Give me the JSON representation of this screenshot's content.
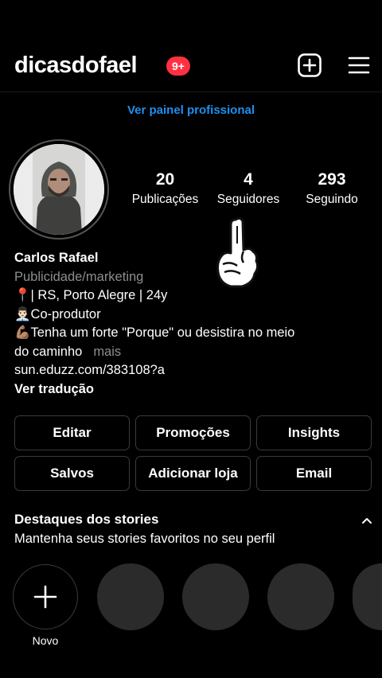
{
  "header": {
    "username": "dicasdofael",
    "notification_badge": "9+",
    "add_icon": "plus-square-icon",
    "menu_icon": "hamburger-menu-icon"
  },
  "professional_dashboard_link": "Ver painel profissional",
  "profile": {
    "stats": [
      {
        "value": "20",
        "label": "Publicações"
      },
      {
        "value": "4",
        "label": "Seguidores"
      },
      {
        "value": "293",
        "label": "Seguindo"
      }
    ],
    "name": "Carlos Rafael",
    "category": "Publicidade/marketing",
    "bio_lines": [
      "📍| RS, Porto Alegre | 24y",
      "👨🏻‍💼Co-produtor",
      "💪🏽Tenha um forte \"Porque\" ou desistira no meio",
      "do caminho"
    ],
    "more_label": "mais",
    "link": "sun.eduzz.com/383108?a",
    "translate_label": "Ver tradução"
  },
  "action_buttons": [
    [
      "Editar",
      "Promoções",
      "Insights"
    ],
    [
      "Salvos",
      "Adicionar loja",
      "Email"
    ]
  ],
  "highlights": {
    "title": "Destaques dos stories",
    "subtitle": "Mantenha seus stories favoritos no seu perfil",
    "new_label": "Novo"
  },
  "colors": {
    "background": "#000000",
    "link_blue": "#1f8ff0",
    "badge_red": "#ff3040",
    "muted_gray": "#8e8e8e"
  }
}
